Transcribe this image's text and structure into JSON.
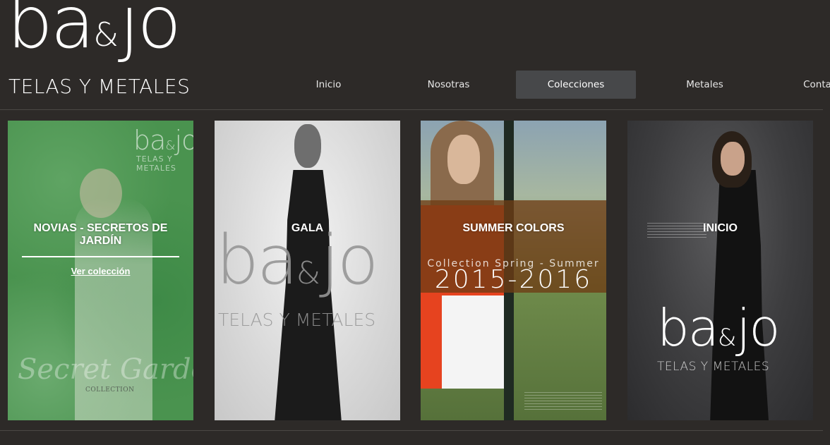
{
  "logo": {
    "word_left": "ba",
    "amp": "&",
    "word_right": "jo",
    "tagline": "TELAS Y METALES"
  },
  "nav": {
    "items": [
      {
        "label": "Inicio",
        "active": false
      },
      {
        "label": "Nosotras",
        "active": false
      },
      {
        "label": "Colecciones",
        "active": true
      },
      {
        "label": "Metales",
        "active": false
      },
      {
        "label": "Contacto",
        "active": false
      }
    ]
  },
  "collections": [
    {
      "title": "NOVIAS - SECRETOS DE JARDÍN",
      "link": "Ver colección",
      "image_text": {
        "logo_left": "ba",
        "logo_amp": "&",
        "logo_right": "jo",
        "logo_tag": "TELAS Y METALES",
        "script": "Secret Garden",
        "script_sub": "COLLECTION"
      }
    },
    {
      "title": "GALA",
      "image_text": {
        "logo_left": "ba",
        "logo_amp": "&",
        "logo_right": "jo",
        "logo_tag": "TELAS Y METALES"
      }
    },
    {
      "title": "SUMMER COLORS",
      "image_text": {
        "line": "Collection Spring - Summer",
        "years": "2015-2016"
      }
    },
    {
      "title": "INICIO",
      "image_text": {
        "logo_left": "ba",
        "logo_amp": "&",
        "logo_right": "jo",
        "logo_tag": "TELAS Y METALES"
      }
    }
  ],
  "colors": {
    "background": "#2d2a28",
    "nav_active": "#47484a",
    "card1_overlay": "#4a934f",
    "card3_band": "#6e3c14"
  }
}
